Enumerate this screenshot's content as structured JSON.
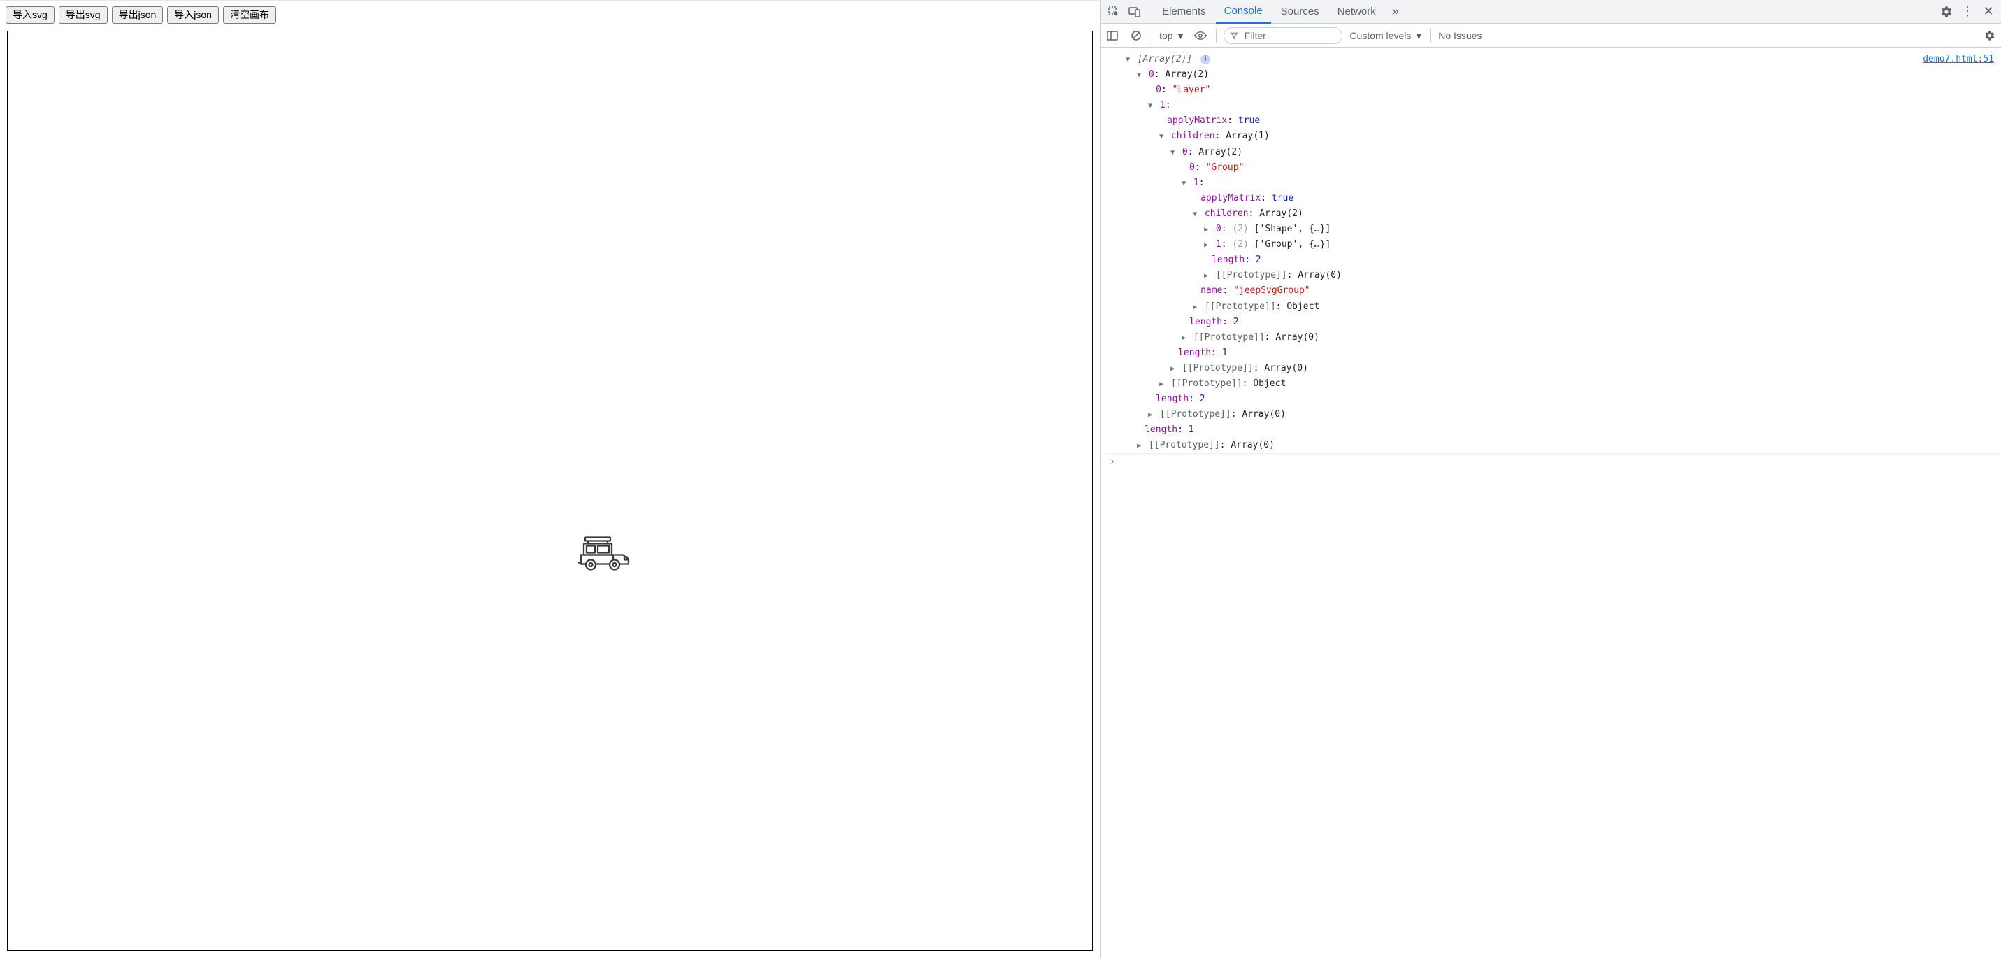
{
  "toolbar": {
    "import_svg": "导入svg",
    "export_svg": "导出svg",
    "export_json": "导出json",
    "import_json": "导入json",
    "clear_canvas": "清空画布"
  },
  "devtools": {
    "tabs": {
      "elements": "Elements",
      "console": "Console",
      "sources": "Sources",
      "network": "Network"
    },
    "subbar": {
      "context": "top",
      "filter_placeholder": "Filter",
      "levels": "Custom levels",
      "issues": "No Issues"
    },
    "source_link": "demo7.html:51",
    "log": {
      "root_label": "[Array(2)]",
      "l0": "0",
      "l0_type": "Array(2)",
      "l0_0_val": "\"Layer\"",
      "l0_1": "1",
      "applyMatrix": "applyMatrix",
      "true": "true",
      "children": "children",
      "arr1": "Array(1)",
      "arr2": "Array(2)",
      "arr0": "Array(0)",
      "c0_0_val": "\"Group\"",
      "idx0": "0",
      "idx1": "1",
      "two_paren": "(2)",
      "shape_arr": "['Shape', {…}]",
      "group_arr": "['Group', {…}]",
      "length": "length",
      "len2": "2",
      "len1": "1",
      "proto": "[[Prototype]]",
      "object": "Object",
      "name": "name",
      "name_val": "\"jeepSvgGroup\""
    },
    "prompt": "›"
  }
}
